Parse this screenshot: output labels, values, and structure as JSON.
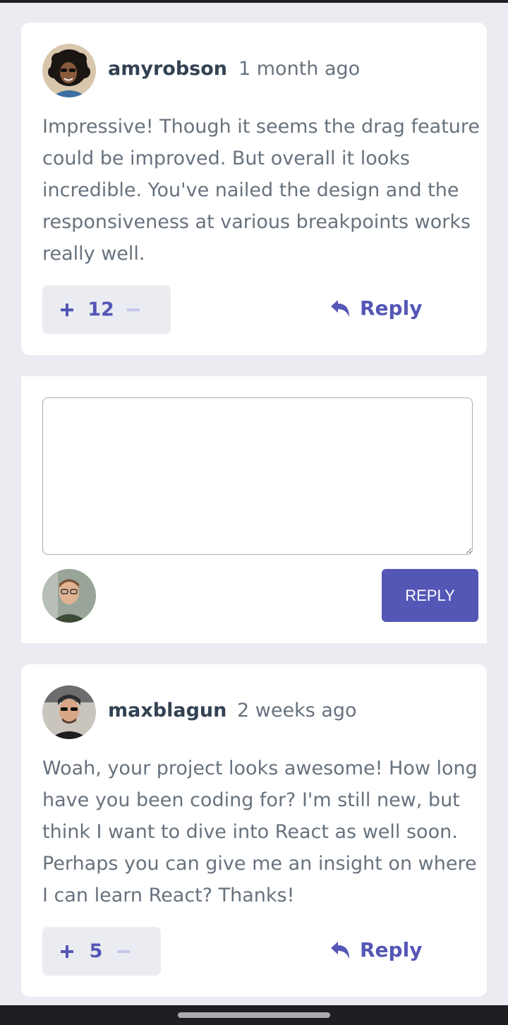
{
  "comments": [
    {
      "username": "amyrobson",
      "timestamp": "1 month ago",
      "text": "Impressive! Though it seems the drag feature could be improved. But overall it looks incredible. You've nailed the design and the responsiveness at various breakpoints works really well.",
      "score": "12",
      "upvote_label": "+",
      "downvote_label": "−",
      "reply_label": "Reply",
      "avatar_icon": "avatar-amyrobson"
    },
    {
      "username": "maxblagun",
      "timestamp": "2 weeks ago",
      "text": "Woah, your project looks awesome! How long have you been coding for? I'm still new, but think I want to dive into React as well soon. Perhaps you can give me an insight on where I can learn React? Thanks!",
      "score": "5",
      "upvote_label": "+",
      "downvote_label": "−",
      "reply_label": "Reply",
      "avatar_icon": "avatar-maxblagun"
    }
  ],
  "reply_form": {
    "textarea_value": "",
    "textarea_placeholder": "",
    "submit_label": "REPLY",
    "current_user_avatar_icon": "avatar-current-user"
  },
  "colors": {
    "background": "#eaecf1",
    "card": "#ffffff",
    "accent": "#5457b6",
    "accent_light": "#c5c6ef",
    "text_dark": "#334253",
    "text_muted": "#67727e"
  },
  "icons": {
    "reply": "reply-arrow-icon",
    "plus": "plus-icon",
    "minus": "minus-icon"
  }
}
